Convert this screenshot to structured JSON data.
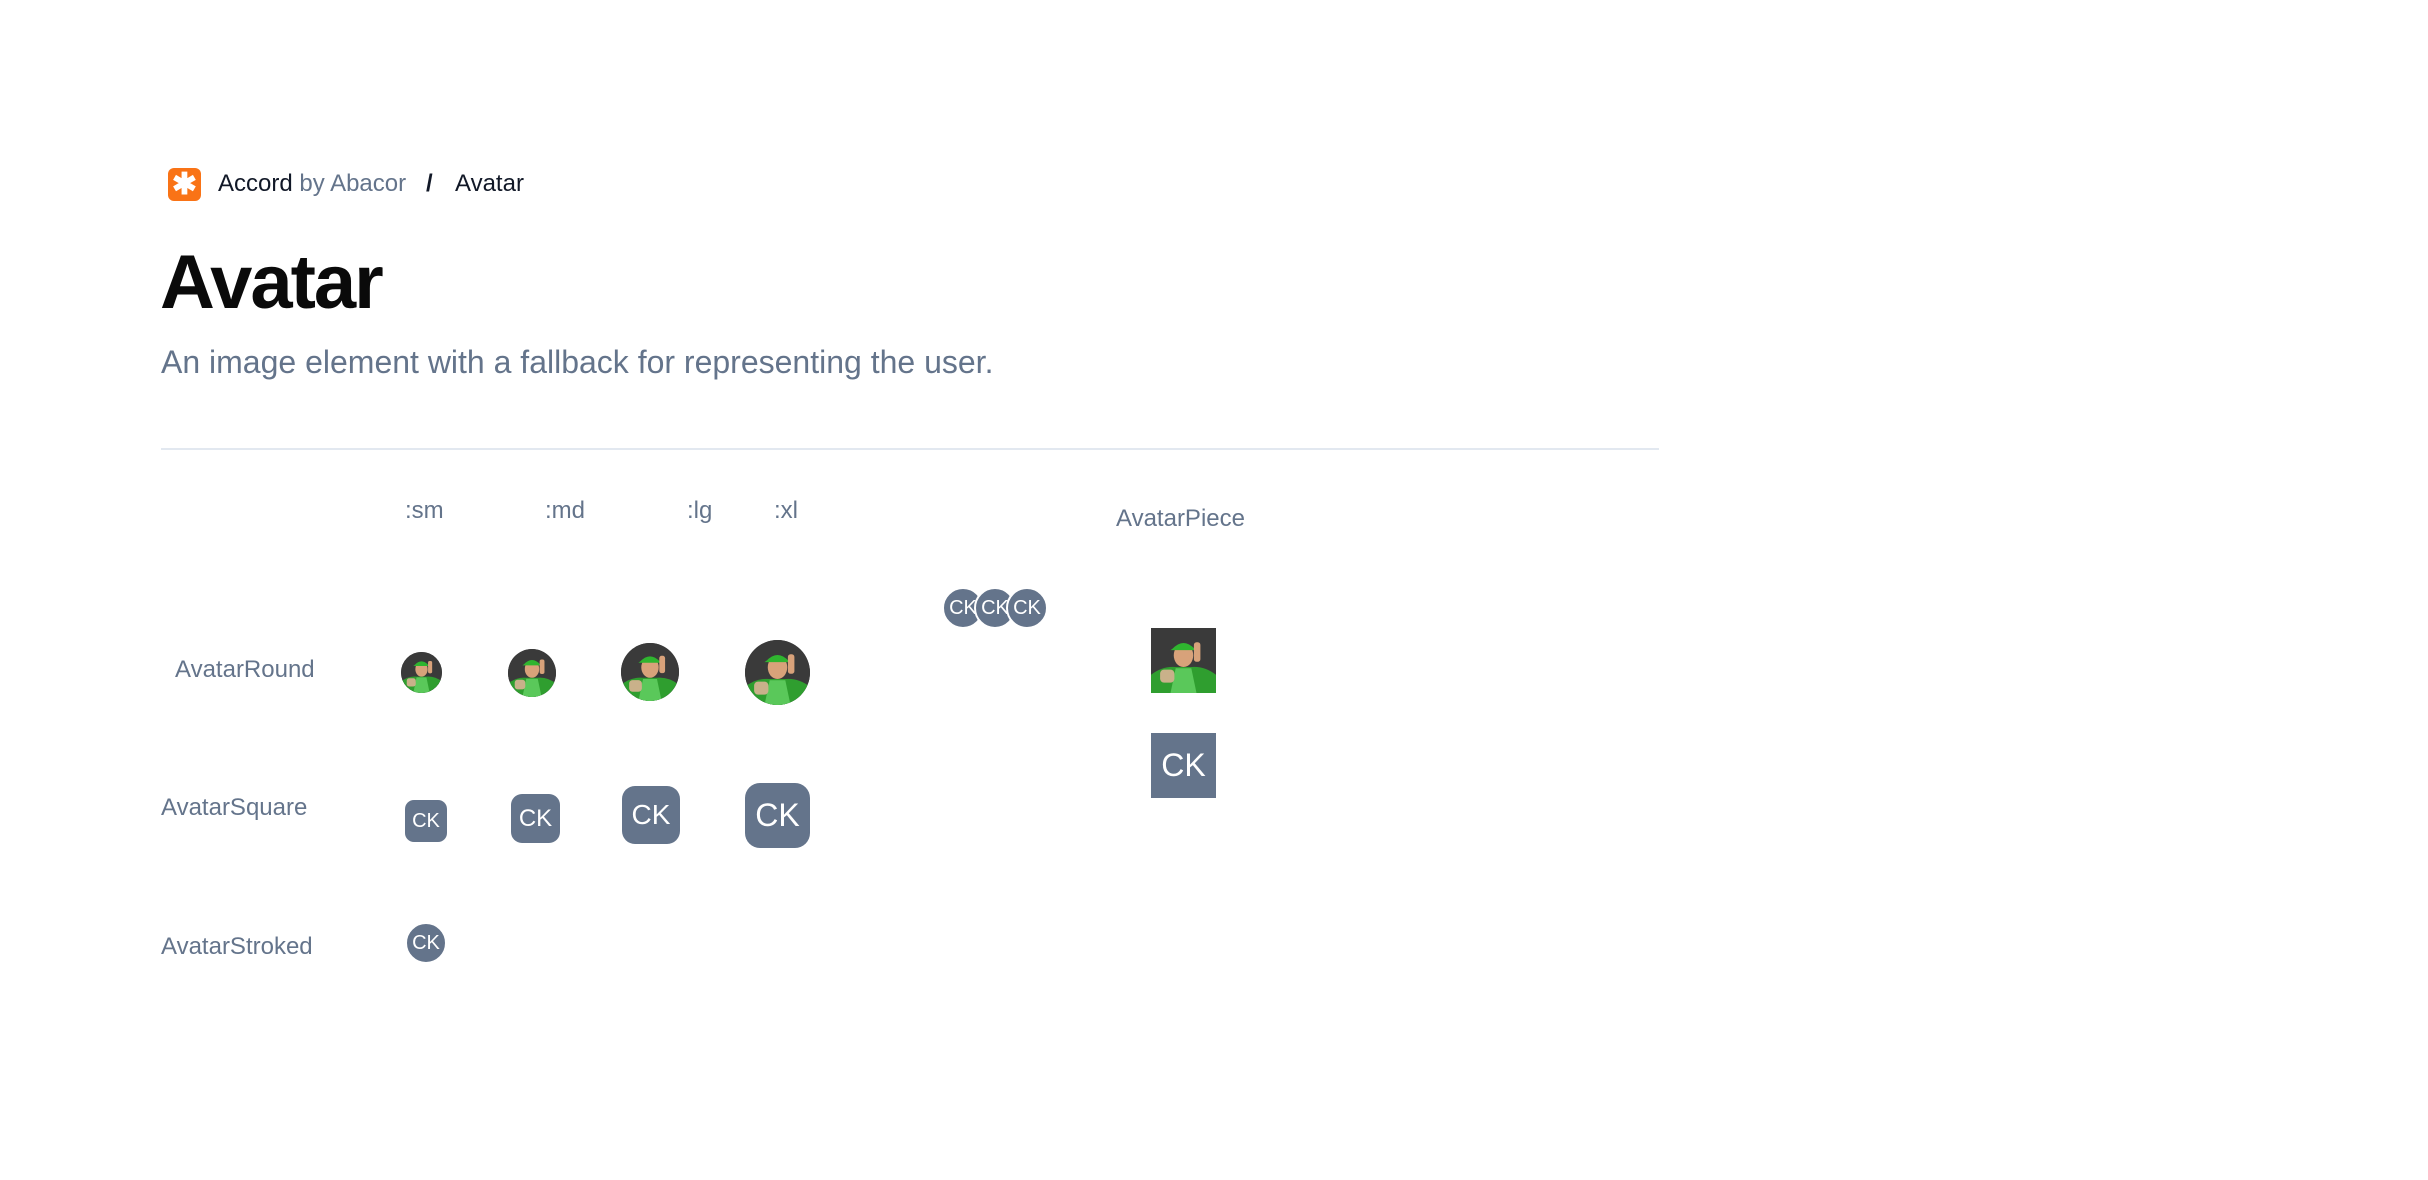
{
  "breadcrumb": {
    "brand": "Accord",
    "by": "by Abacor",
    "separator": "/",
    "page": "Avatar"
  },
  "page": {
    "title": "Avatar",
    "description": "An image element with a fallback for representing the user."
  },
  "columns": {
    "sm": ":sm",
    "md": ":md",
    "lg": ":lg",
    "xl": ":xl",
    "piece": "AvatarPiece"
  },
  "rows": {
    "round": "AvatarRound",
    "square": "AvatarSquare",
    "stroked": "AvatarStroked"
  },
  "avatar": {
    "initials": "CK",
    "fallback_color": "#64748b",
    "image": "wrestler-photo"
  },
  "colors": {
    "brand": "#f97316",
    "muted_text": "#64748b",
    "divider": "#e2e8f0"
  }
}
